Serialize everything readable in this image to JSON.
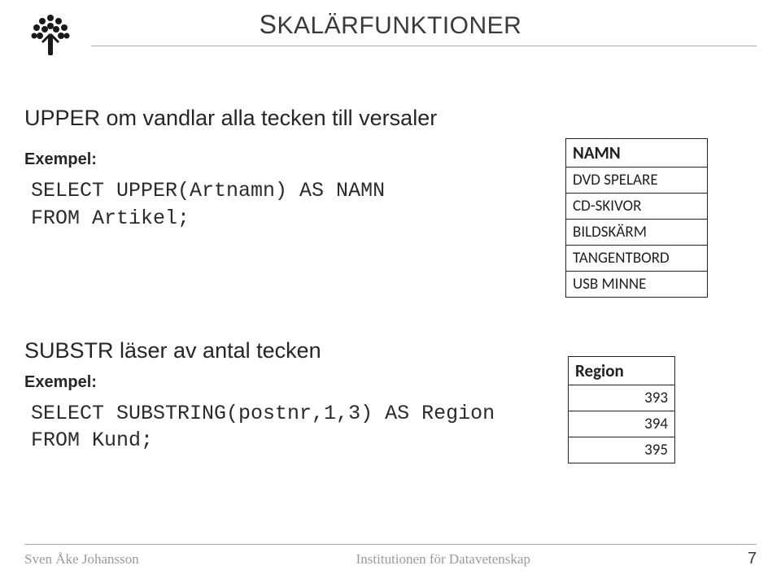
{
  "header": {
    "title_html": "SKALÄRFUNKTIONER"
  },
  "section1": {
    "intro": "UPPER om vandlar alla tecken till versaler",
    "example_label": "Exempel:",
    "code": "SELECT UPPER(Artnamn) AS NAMN\nFROM Artikel;"
  },
  "section2": {
    "intro": "SUBSTR läser av antal tecken",
    "example_label": "Exempel:",
    "code": "SELECT SUBSTRING(postnr,1,3) AS Region\nFROM Kund;"
  },
  "tables": {
    "namn": {
      "header": "NAMN",
      "rows": [
        "DVD SPELARE",
        "CD-SKIVOR",
        "BILDSKÄRM",
        "TANGENTBORD",
        "USB MINNE"
      ]
    },
    "region": {
      "header": "Region",
      "rows": [
        "393",
        "394",
        "395"
      ]
    }
  },
  "footer": {
    "author": "Sven Åke Johansson",
    "inst": "Institutionen för Datavetenskap",
    "page": "7"
  }
}
